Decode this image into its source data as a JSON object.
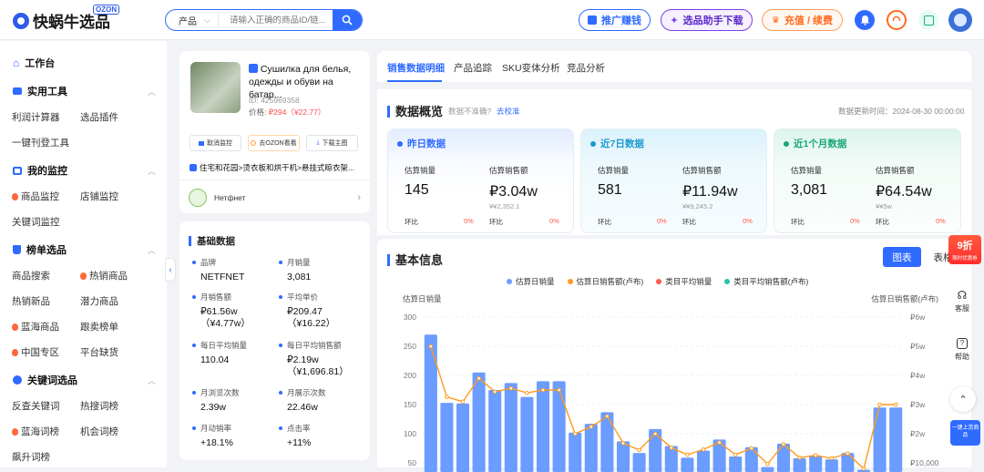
{
  "header": {
    "logo_text": "快蜗牛选品",
    "logo_badge": "OZON",
    "search_category": "产品",
    "search_placeholder": "请输入正确的商品ID/链...",
    "btn_promote": "推广赚钱",
    "btn_assistant": "选品助手下载",
    "btn_recharge": "充值 / 续费",
    "colors": {
      "accent": "#2f6bff",
      "assistant": "#7b3fe4",
      "recharge": "#ff7a2e"
    }
  },
  "sidebar": {
    "home": "工作台",
    "sections": [
      {
        "title": "实用工具",
        "items": [
          "利润计算器",
          "选品插件",
          "一键刊登工具"
        ]
      },
      {
        "title": "我的监控",
        "items": [
          "商品监控",
          "店铺监控",
          "关键词监控"
        ]
      },
      {
        "title": "榜单选品",
        "items": [
          "商品搜索",
          "热销商品",
          "热销新品",
          "潜力商品",
          "蓝海商品",
          "跟卖榜单",
          "中国专区",
          "平台缺货"
        ]
      },
      {
        "title": "关键词选品",
        "items": [
          "反查关键词",
          "热搜词榜",
          "蓝海词榜",
          "机会词榜",
          "飙升词榜"
        ]
      }
    ]
  },
  "product": {
    "title": "Сушилка для белья, одежды и обуви на батар...",
    "id": "ID: 425969358",
    "price_label": "价格: ",
    "price": "₽294（¥22.77）",
    "btn_unmonitor": "取消监控",
    "btn_ozon": "去OZON看看",
    "btn_download": "下载主图",
    "category": "住宅和花园>烫衣板和烘干机>悬挂式晾衣架...",
    "seller": "Нетфнет"
  },
  "basic": {
    "title": "基础数据",
    "fields": [
      {
        "label": "品牌",
        "value": "NETFNET"
      },
      {
        "label": "月销量",
        "value": "3,081"
      },
      {
        "label": "月销售额",
        "value": "₽61.56w",
        "value2": "（¥4.77w）"
      },
      {
        "label": "平均单价",
        "value": "₽209.47",
        "value2": "（¥16.22）"
      },
      {
        "label": "每日平均销量",
        "value": "110.04"
      },
      {
        "label": "每日平均销售额",
        "value": "₽2.19w",
        "value2": "（¥1,696.81）"
      },
      {
        "label": "月浏览次数",
        "value": "2.39w"
      },
      {
        "label": "月展示次数",
        "value": "22.46w"
      },
      {
        "label": "月动销率",
        "value": "+18.1%"
      },
      {
        "label": "点击率",
        "value": "+11%"
      }
    ]
  },
  "tabs": [
    "销售数据明细",
    "产品追踪",
    "SKU变体分析",
    "竞品分析"
  ],
  "overview": {
    "title": "数据概览",
    "inaccurate": "数据不准确?",
    "calibrate": "去校准",
    "updated": "数据更新时间：2024-08-30 00:00:00",
    "cards": [
      {
        "title": "昨日数据",
        "l1": "估算销量",
        "v1": "145",
        "l2": "估算销售额",
        "v2": "₽3.04w",
        "sub": "¥2,352.1",
        "cmp": "环比",
        "p1": "0%",
        "p2": "0%"
      },
      {
        "title": "近7日数据",
        "l1": "估算销量",
        "v1": "581",
        "l2": "估算销售额",
        "v2": "₽11.94w",
        "sub": "¥9,245.2",
        "cmp": "环比",
        "p1": "0%",
        "p2": "0%"
      },
      {
        "title": "近1个月数据",
        "l1": "估算销量",
        "v1": "3,081",
        "l2": "估算销售额",
        "v2": "₽64.54w",
        "sub": "¥5w",
        "cmp": "环比",
        "p1": "0%",
        "p2": "0%"
      }
    ]
  },
  "basic_info": {
    "title": "基本信息",
    "btn_chart": "图表",
    "btn_table": "表格",
    "discount": "9折",
    "discount_sub": "限时优惠券"
  },
  "right_float": {
    "service": "客服",
    "help": "帮助",
    "collect": "一键上货商品"
  },
  "chart_data": {
    "type": "bar",
    "left_axis_label": "估算日销量",
    "right_axis_label": "估算日销售额(卢布)",
    "legend": [
      "估算日销量",
      "估算日销售额(卢布)",
      "类目平均销量",
      "类目平均销售额(卢布)"
    ],
    "ylim": [
      50,
      300
    ],
    "yticks": [
      "300",
      "250",
      "200",
      "150",
      "100",
      "50"
    ],
    "y2ticks": [
      "₽6w",
      "₽5w",
      "₽4w",
      "₽3w",
      "₽2w",
      "₽10,000"
    ],
    "series": [
      {
        "name": "估算日销量",
        "values": [
          270,
          153,
          152,
          205,
          175,
          187,
          163,
          190,
          190,
          102,
          117,
          137,
          87,
          67,
          108,
          79,
          59,
          71,
          90,
          61,
          77,
          43,
          83,
          58,
          62,
          56,
          67,
          38,
          145,
          145
        ]
      },
      {
        "name": "估算日销售额(卢布)",
        "values": [
          250,
          163,
          155,
          195,
          172,
          178,
          170,
          175,
          175,
          100,
          112,
          130,
          84,
          72,
          100,
          76,
          64,
          73,
          85,
          64,
          75,
          48,
          82,
          59,
          63,
          58,
          66,
          40,
          150,
          150
        ]
      }
    ]
  }
}
